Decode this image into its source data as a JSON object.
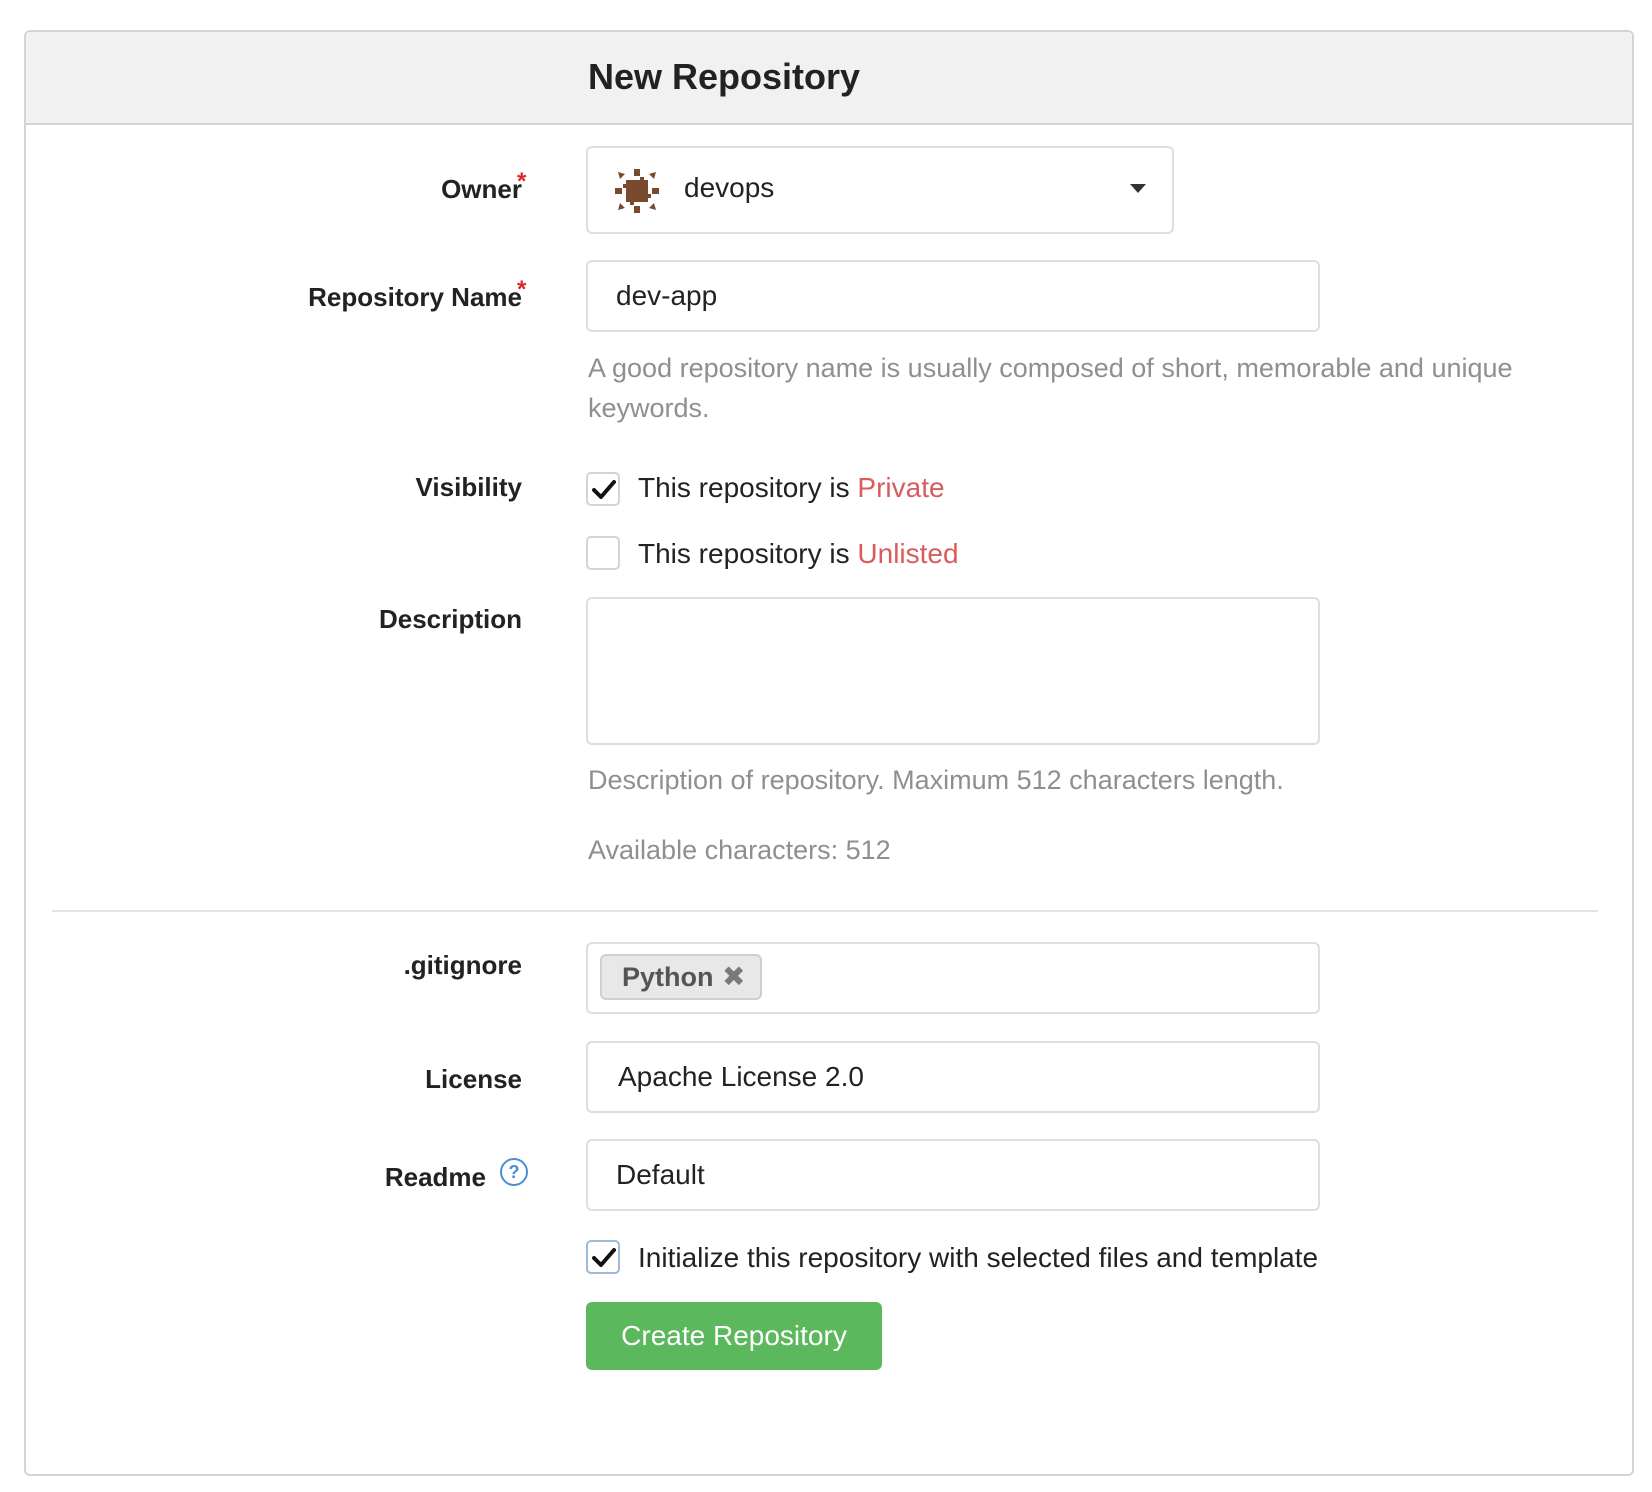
{
  "header": {
    "title": "New Repository"
  },
  "owner": {
    "label": "Owner",
    "required_mark": "*",
    "value": "devops",
    "avatar_icon": "owner-avatar-icon"
  },
  "repo_name": {
    "label": "Repository Name",
    "required_mark": "*",
    "value": "dev-app",
    "help": "A good repository name is usually composed of short, memorable and unique keywords."
  },
  "visibility": {
    "label": "Visibility",
    "private": {
      "checked": true,
      "prefix": "This repository is",
      "accent": "Private"
    },
    "unlisted": {
      "checked": false,
      "prefix": "This repository is",
      "accent": "Unlisted"
    }
  },
  "description": {
    "label": "Description",
    "value": "",
    "help": "Description of repository. Maximum 512 characters length.",
    "available": "Available characters: 512"
  },
  "gitignore": {
    "label": ".gitignore",
    "tags": [
      "Python"
    ],
    "remove_icon": "close-icon"
  },
  "license": {
    "label": "License",
    "value": "Apache License 2.0"
  },
  "readme": {
    "label": "Readme",
    "value": "Default",
    "help_icon": "question-circle-icon"
  },
  "init": {
    "checked": true,
    "label": "Initialize this repository with selected files and template"
  },
  "submit": {
    "label": "Create Repository"
  },
  "colors": {
    "accent": "#d95c5c",
    "primary_button": "#5cb85c",
    "required": "#db2828",
    "help_icon": "#4a8fd0"
  }
}
